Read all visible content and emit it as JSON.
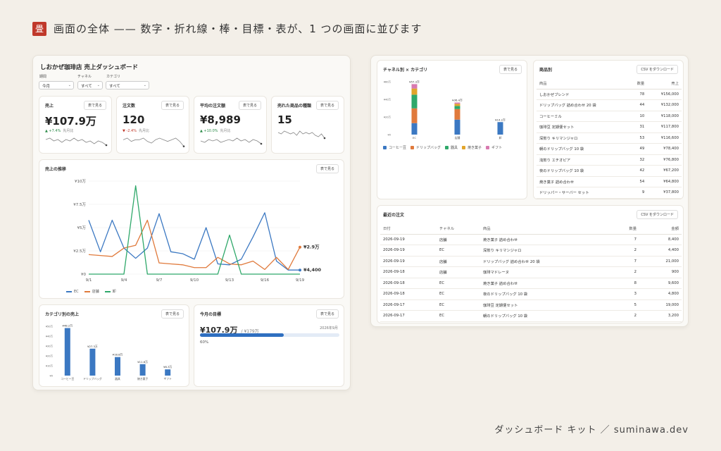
{
  "headline": {
    "logo": "畳",
    "text": "画面の全体 —— 数字・折れ線・棒・目標・表が、1 つの画面に並びます"
  },
  "footer": "ダッシュボード キット ／ suminawa.dev",
  "dashboard": {
    "title": "しおかぜ珈琲店 売上ダッシュボード",
    "filters": [
      {
        "label": "期間",
        "value": "今月"
      },
      {
        "label": "チャネル",
        "value": "すべて"
      },
      {
        "label": "カテゴリ",
        "value": "すべて"
      }
    ],
    "table_button": "表で見る",
    "kpis": [
      {
        "title": "売上",
        "value": "¥107.9万",
        "delta": "▲ +7.4%",
        "delta_sub": "先月比",
        "positive": true,
        "spark": [
          6,
          7,
          5,
          6,
          4,
          6,
          5,
          7,
          5,
          6,
          4,
          5,
          3,
          5,
          4,
          2
        ]
      },
      {
        "title": "注文数",
        "value": "120",
        "delta": "▼ -2.4%",
        "delta_sub": "先月比",
        "positive": false,
        "spark": [
          5,
          6,
          4,
          5,
          5,
          6,
          4,
          3,
          5,
          6,
          5,
          4,
          5,
          6,
          4,
          1
        ]
      },
      {
        "title": "平均の注文額",
        "value": "¥8,989",
        "delta": "▲ +10.0%",
        "delta_sub": "先月比",
        "positive": true,
        "spark": [
          5,
          4,
          6,
          5,
          6,
          4,
          5,
          6,
          5,
          7,
          5,
          6,
          4,
          6,
          5,
          3
        ]
      },
      {
        "title": "売れた商品の種類",
        "value": "15",
        "delta": "",
        "delta_sub": "",
        "positive": true,
        "spark": [
          6,
          5,
          7,
          6,
          5,
          6,
          4,
          7,
          5,
          6,
          5,
          6,
          4,
          3,
          5,
          2
        ]
      }
    ],
    "trend": {
      "title": "売上の推移",
      "legend": [
        "EC",
        "店舗",
        "卸"
      ],
      "end_labels": {
        "store": "¥2.9万",
        "ec": "¥4,400"
      }
    },
    "category_sales": {
      "title": "カテゴリ別の売上"
    },
    "goal": {
      "title": "今月の目標",
      "value": "¥107.9万",
      "target": "/ ¥179万",
      "month": "2026年9月",
      "percent_label": "60%",
      "progress": 0.6
    },
    "channel_category": {
      "title": "チャネル別 × カテゴリ",
      "legend": [
        "コーヒー豆",
        "ドリップバッグ",
        "器具",
        "焼き菓子",
        "ギフト"
      ]
    },
    "products": {
      "title": "商品別",
      "button": "CSV をダウンロード",
      "headers": [
        "商品",
        "数量",
        "売上"
      ],
      "rows": [
        [
          "しおかぜブレンド",
          "78",
          "¥156,000"
        ],
        [
          "ドリップバッグ 詰め合わせ 20 袋",
          "44",
          "¥132,000"
        ],
        [
          "コーヒーミル",
          "10",
          "¥118,000"
        ],
        [
          "珈琲豆 定期便セット",
          "31",
          "¥117,800"
        ],
        [
          "深煎り キリマンジャロ",
          "53",
          "¥116,600"
        ],
        [
          "朝のドリップバッグ 10 袋",
          "49",
          "¥78,400"
        ],
        [
          "浅煎り エチオピア",
          "32",
          "¥76,800"
        ],
        [
          "夜のドリップバッグ 10 袋",
          "42",
          "¥67,200"
        ],
        [
          "焼き菓子 詰め合わせ",
          "54",
          "¥64,800"
        ],
        [
          "ドリッパー・サーバー セット",
          "9",
          "¥37,800"
        ]
      ]
    },
    "orders": {
      "title": "最近の注文",
      "button": "CSV をダウンロード",
      "headers": [
        "日付",
        "チャネル",
        "商品",
        "数量",
        "金額"
      ],
      "rows": [
        [
          "2026-09-19",
          "店舗",
          "焼き菓子 詰め合わせ",
          "7",
          "8,400"
        ],
        [
          "2026-09-19",
          "EC",
          "深煎り キリマンジャロ",
          "2",
          "4,400"
        ],
        [
          "2026-09-19",
          "店舗",
          "ドリップバッグ 詰め合わせ 20 袋",
          "7",
          "21,000"
        ],
        [
          "2026-09-18",
          "店舗",
          "珈琲マドレーヌ",
          "2",
          "900"
        ],
        [
          "2026-09-18",
          "EC",
          "焼き菓子 詰め合わせ",
          "8",
          "9,600"
        ],
        [
          "2026-09-18",
          "EC",
          "夜のドリップバッグ 10 袋",
          "3",
          "4,800"
        ],
        [
          "2026-09-17",
          "EC",
          "珈琲豆 定期便セット",
          "5",
          "19,000"
        ],
        [
          "2026-09-17",
          "EC",
          "朝のドリップバッグ 10 袋",
          "2",
          "3,200"
        ]
      ]
    }
  },
  "colors": {
    "ec": "#3b78c2",
    "store": "#e07a3c",
    "wholesale": "#2fa86a",
    "bean": "#3b78c2",
    "drip": "#e07a3c",
    "tool": "#2fa86a",
    "sweets": "#e2a52b",
    "gift": "#d87ab0",
    "accent": "#c0392b"
  },
  "chart_data": [
    {
      "type": "line",
      "title": "売上の推移",
      "x": [
        "9/1",
        "9/2",
        "9/3",
        "9/4",
        "9/5",
        "9/6",
        "9/7",
        "9/8",
        "9/9",
        "9/10",
        "9/11",
        "9/12",
        "9/13",
        "9/14",
        "9/15",
        "9/16",
        "9/17",
        "9/18",
        "9/19"
      ],
      "x_ticks": [
        "9/1",
        "9/4",
        "9/7",
        "9/10",
        "9/13",
        "9/16",
        "9/19"
      ],
      "y_ticks": [
        "¥0",
        "¥2.5万",
        "¥5万",
        "¥7.5万",
        "¥10万"
      ],
      "ylim": [
        0,
        100000
      ],
      "series": [
        {
          "name": "EC",
          "values": [
            58000,
            24000,
            58000,
            28000,
            17000,
            28000,
            65000,
            24000,
            22000,
            16000,
            50000,
            11000,
            10000,
            16000,
            40000,
            66000,
            14000,
            4400,
            4400
          ]
        },
        {
          "name": "店舗",
          "values": [
            21000,
            20000,
            19000,
            28000,
            31000,
            58000,
            12000,
            11000,
            10000,
            7000,
            7000,
            18000,
            11000,
            10000,
            14000,
            5000,
            18000,
            5000,
            29000
          ]
        },
        {
          "name": "卸",
          "values": [
            0,
            0,
            0,
            0,
            95000,
            0,
            0,
            0,
            0,
            0,
            0,
            0,
            42000,
            0,
            0,
            0,
            0,
            0,
            0
          ]
        }
      ]
    },
    {
      "type": "bar",
      "title": "カテゴリ別の売上",
      "categories": [
        "コーヒー豆",
        "ドリップバッグ",
        "器具",
        "焼き菓子",
        "ギフト"
      ],
      "values": [
        48.2,
        27.3,
        18.8,
        11.6,
        6.3
      ],
      "data_labels": [
        "¥48.2万",
        "¥27.3万",
        "¥18.8万",
        "¥11.6万",
        "¥6.3万"
      ],
      "y_ticks": [
        "¥0",
        "¥10万",
        "¥20万",
        "¥30万",
        "¥40万",
        "¥50万"
      ],
      "ylim": [
        0,
        50
      ]
    },
    {
      "type": "bar",
      "stacked": true,
      "title": "チャネル別 × カテゴリ",
      "categories": [
        "EC",
        "店舗",
        "卸"
      ],
      "data_labels": [
        "¥57.3万",
        "¥36.4万",
        "¥14.2万"
      ],
      "y_ticks": [
        "¥0",
        "¥20万",
        "¥40万",
        "¥60万"
      ],
      "ylim": [
        0,
        60
      ],
      "series": [
        {
          "name": "コーヒー豆",
          "values": [
            13,
            17,
            14.2
          ]
        },
        {
          "name": "ドリップバッグ",
          "values": [
            16.8,
            12,
            0
          ]
        },
        {
          "name": "器具",
          "values": [
            15.5,
            3.5,
            0
          ]
        },
        {
          "name": "焼き菓子",
          "values": [
            7,
            2.5,
            0
          ]
        },
        {
          "name": "ギフト",
          "values": [
            5,
            1.4,
            0
          ]
        }
      ]
    }
  ]
}
